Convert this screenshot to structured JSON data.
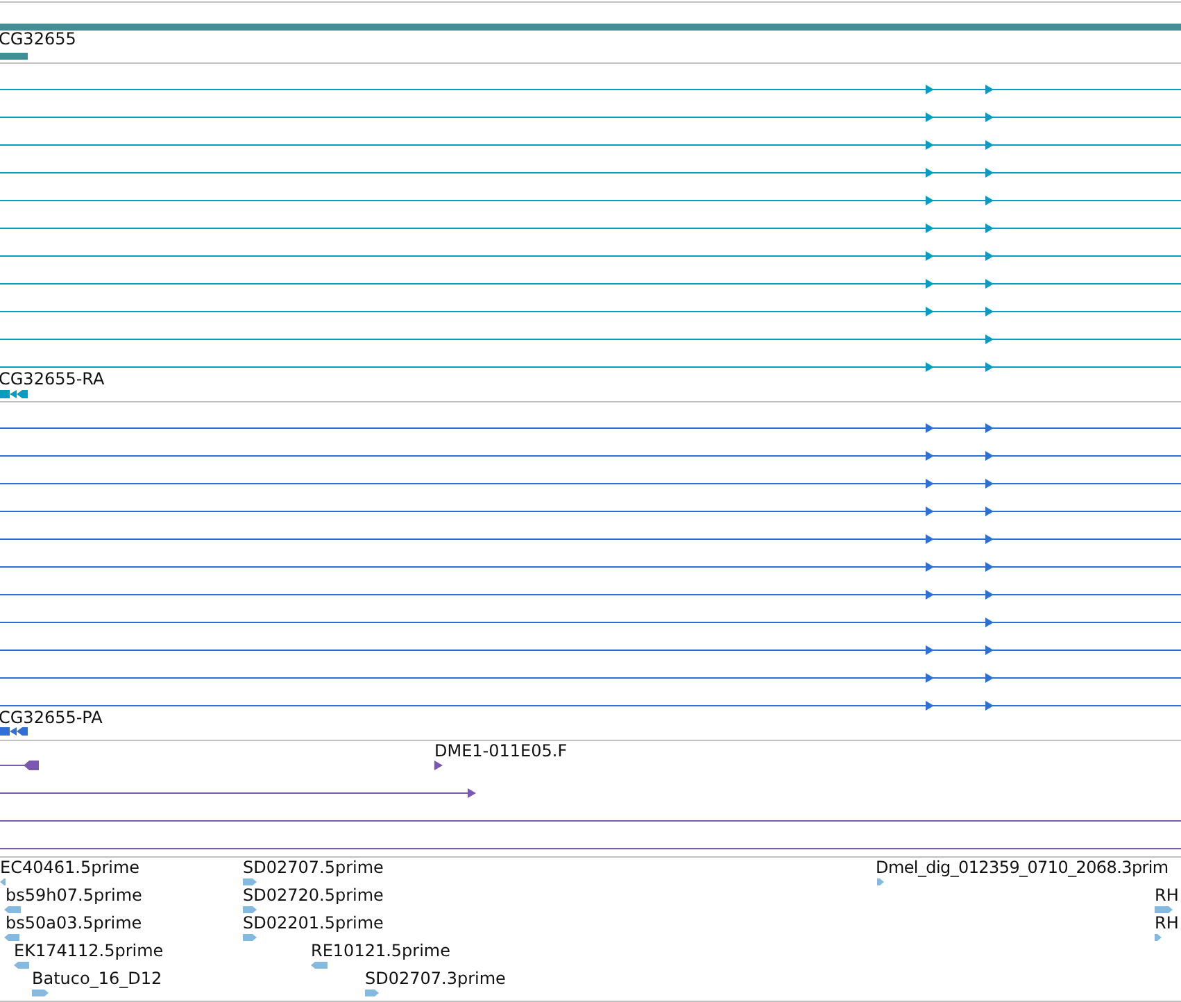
{
  "gene_track": {
    "label": "CG32655"
  },
  "transcript_track": {
    "label": "CG32655-RA",
    "rows": [
      {
        "kind": "two_markers"
      },
      {
        "kind": "two_markers"
      },
      {
        "kind": "two_markers"
      },
      {
        "kind": "two_markers"
      },
      {
        "kind": "two_markers"
      },
      {
        "kind": "two_markers"
      },
      {
        "kind": "two_markers"
      },
      {
        "kind": "two_markers"
      },
      {
        "kind": "two_markers"
      },
      {
        "kind": "one_marker"
      },
      {
        "kind": "two_markers"
      }
    ]
  },
  "protein_track": {
    "label": "CG32655-PA",
    "rows": [
      {
        "kind": "two_markers"
      },
      {
        "kind": "two_markers"
      },
      {
        "kind": "two_markers"
      },
      {
        "kind": "two_markers"
      },
      {
        "kind": "two_markers"
      },
      {
        "kind": "two_markers"
      },
      {
        "kind": "two_markers"
      },
      {
        "kind": "one_marker"
      },
      {
        "kind": "two_markers"
      },
      {
        "kind": "two_markers"
      },
      {
        "kind": "two_markers"
      }
    ]
  },
  "alignment_track": {
    "label": "DME1-011E05.F",
    "rows": [
      {
        "kind": "end_block"
      },
      {
        "kind": "end_arrow"
      },
      {
        "kind": "line"
      },
      {
        "kind": "line"
      }
    ]
  },
  "est_track": {
    "features": [
      {
        "label": "EC40461.5prime",
        "kind": "reverse"
      },
      {
        "label": "bs59h07.5prime",
        "kind": "reverse"
      },
      {
        "label": "bs50a03.5prime",
        "kind": "reverse"
      },
      {
        "label": "EK174112.5prime",
        "kind": "reverse"
      },
      {
        "label": "Batuco_16_D12",
        "kind": "forward"
      },
      {
        "label": "SD02707.5prime",
        "kind": "forward"
      },
      {
        "label": "SD02720.5prime",
        "kind": "forward"
      },
      {
        "label": "SD02201.5prime",
        "kind": "forward"
      },
      {
        "label": "RE10121.5prime",
        "kind": "reverse"
      },
      {
        "label": "SD02707.3prime",
        "kind": "forward"
      },
      {
        "label": "Dmel_dig_012359_0710_2068.3prim",
        "kind": "forward"
      },
      {
        "label": "RH",
        "kind": "forward"
      },
      {
        "label": "RH",
        "kind": "forward"
      }
    ]
  }
}
